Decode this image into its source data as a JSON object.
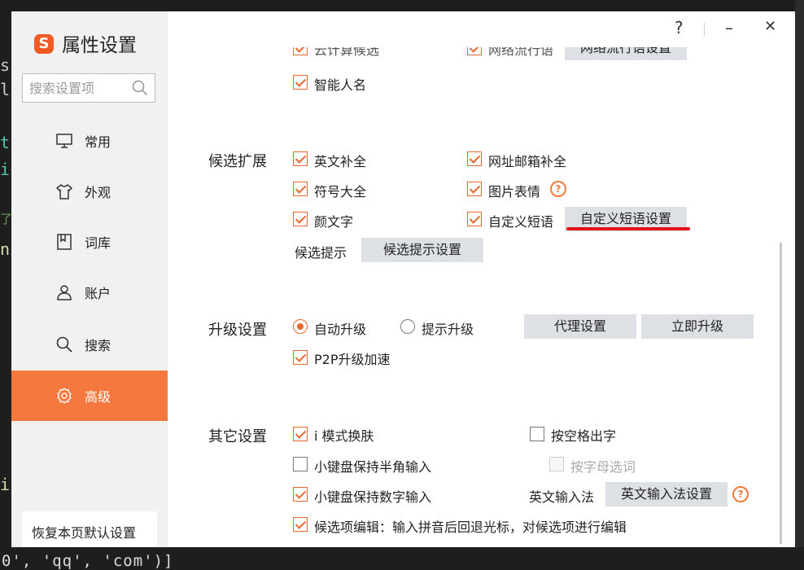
{
  "app": {
    "title": "属性设置",
    "logo_letter": "S"
  },
  "window_controls": {
    "help": "?",
    "minimize": "–",
    "close": "✕"
  },
  "search": {
    "placeholder": "搜索设置项"
  },
  "nav": [
    {
      "label": "常用",
      "icon": "monitor-icon"
    },
    {
      "label": "外观",
      "icon": "shirt-icon"
    },
    {
      "label": "词库",
      "icon": "book-icon"
    },
    {
      "label": "账户",
      "icon": "user-icon"
    },
    {
      "label": "搜索",
      "icon": "search-icon"
    },
    {
      "label": "高级",
      "icon": "gear-icon",
      "active": true
    }
  ],
  "restore_button": "恢复本页默认设置",
  "top_partial": {
    "cloud_label": "云计算候选",
    "slang_label": "网络流行语",
    "slang_button": "网络流行语设置"
  },
  "smart_name": {
    "label": "智能人名",
    "checked": true
  },
  "candidate_ext": {
    "section": "候选扩展",
    "english_completion": {
      "label": "英文补全",
      "checked": true
    },
    "url_email": {
      "label": "网址邮箱补全",
      "checked": true
    },
    "symbols": {
      "label": "符号大全",
      "checked": true
    },
    "image_emoji": {
      "label": "图片表情",
      "checked": true
    },
    "kaomoji": {
      "label": "颜文字",
      "checked": true
    },
    "custom_phrase": {
      "label": "自定义短语",
      "checked": true
    },
    "custom_phrase_button": "自定义短语设置",
    "hint_label": "候选提示",
    "hint_button": "候选提示设置"
  },
  "upgrade": {
    "section": "升级设置",
    "auto": {
      "label": "自动升级",
      "selected": true
    },
    "prompt": {
      "label": "提示升级",
      "selected": false
    },
    "proxy_button": "代理设置",
    "now_button": "立即升级",
    "p2p": {
      "label": "P2P升级加速",
      "checked": true
    }
  },
  "other": {
    "section": "其它设置",
    "i_mode": {
      "label": "i 模式换肤",
      "checked": true
    },
    "space_output": {
      "label": "按空格出字",
      "checked": false
    },
    "keypad_halfwidth": {
      "label": "小键盘保持半角输入",
      "checked": false
    },
    "letter_select": {
      "label": "按字母选词",
      "checked": false,
      "disabled": true
    },
    "keypad_numeric": {
      "label": "小键盘保持数字输入",
      "checked": true
    },
    "english_ime_label": "英文输入法",
    "english_ime_button": "英文输入法设置",
    "candidate_edit": {
      "label": "候选项编辑：输入拼音后回退光标，对候选项进行编辑",
      "checked": true
    }
  },
  "background": {
    "code_bottom": "0', 'qq', 'com')]",
    "side_chars": [
      "s",
      "l",
      "t",
      "i",
      "了",
      "n",
      "i"
    ]
  },
  "colors": {
    "accent": "#f5783e",
    "checkbox": "#e8692e",
    "underline": "#e4121b"
  }
}
